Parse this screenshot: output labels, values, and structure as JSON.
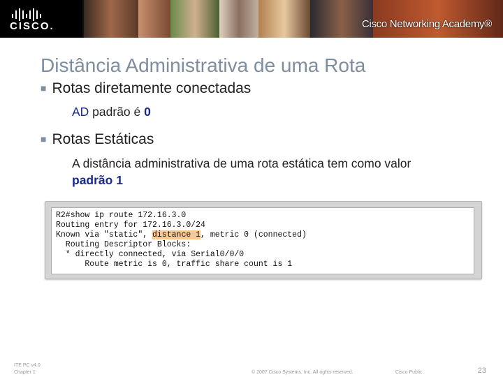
{
  "header": {
    "brand": "CISCO.",
    "academy": "Cisco Networking Academy®"
  },
  "slide": {
    "title": "Distância Administrativa de uma Rota",
    "bullets": [
      {
        "label": "Rotas diretamente conectadas",
        "sub": {
          "prefix": "AD",
          "middle": " padrão é ",
          "suffix": "0"
        }
      },
      {
        "label": "Rotas Estáticas",
        "sub_line1": "A distância administrativa de uma rota estática tem como valor",
        "sub_line2": "padrão 1"
      }
    ]
  },
  "terminal": {
    "lines": [
      "R2#show ip route 172.16.3.0",
      "Routing entry for 172.16.3.0/24",
      "Known via \"static\", ",
      "  Routing Descriptor Blocks:",
      "  * directly connected, via Serial0/0/0",
      "      Route metric is 0, traffic share count is 1"
    ],
    "highlight": "distance 1",
    "line3_suffix": ", metric 0 (connected)"
  },
  "footer": {
    "course": "ITE PC v4.0",
    "chapter": "Chapter 1",
    "copyright": "© 2007 Cisco Systems, Inc. All rights reserved.",
    "classification": "Cisco Public",
    "page": "23"
  }
}
